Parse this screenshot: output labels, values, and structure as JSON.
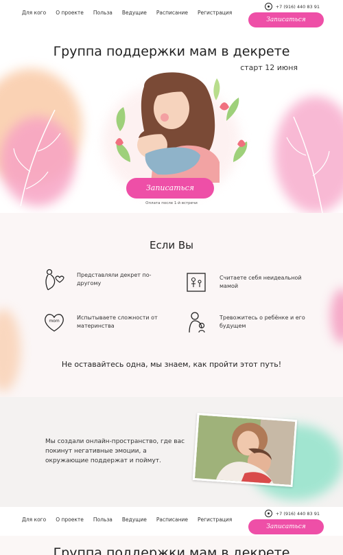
{
  "nav": {
    "links": [
      "Для кого",
      "О проекте",
      "Польза",
      "Ведущие",
      "Расписание",
      "Регистрация"
    ],
    "phone": "+7 (916) 440 83 91",
    "cta": "Записаться"
  },
  "hero": {
    "title": "Группа поддержки мам в декрете",
    "start": "старт 12 июня",
    "cta": "Записаться",
    "note": "Оплата после 1-й встречи"
  },
  "ifyou": {
    "title": "Если Вы",
    "items": [
      {
        "text": "Представляли декрет по-другому",
        "icon": "pregnant-heart-icon"
      },
      {
        "text": "Считаете себя неидеальной мамой",
        "icon": "family-picture-icon"
      },
      {
        "text": "Испытываете сложности от материнства",
        "icon": "mom-heart-icon"
      },
      {
        "text": "Тревожитесь о ребёнке и его будущем",
        "icon": "mother-child-icon"
      }
    ],
    "bottom": "Не оставайтесь одна, мы знаем, как пройти этот путь!"
  },
  "space": {
    "text": "Мы создали онлайн-пространство, где вас покинут негативные эмоции, а окружающие поддержат и поймут."
  },
  "colors": {
    "accent": "#ee4fa7",
    "pink_wash": "#f7b6c9",
    "orange_wash": "#f9c39b",
    "mint_wash": "#7fe0c3"
  },
  "footer_nav": {
    "links": [
      "Для кого",
      "О проекте",
      "Польза",
      "Ведущие",
      "Расписание",
      "Регистрация"
    ],
    "phone": "+7 (916) 440 83 91",
    "cta": "Записаться"
  },
  "cut_title": "Группа поддержки мам в декрете"
}
